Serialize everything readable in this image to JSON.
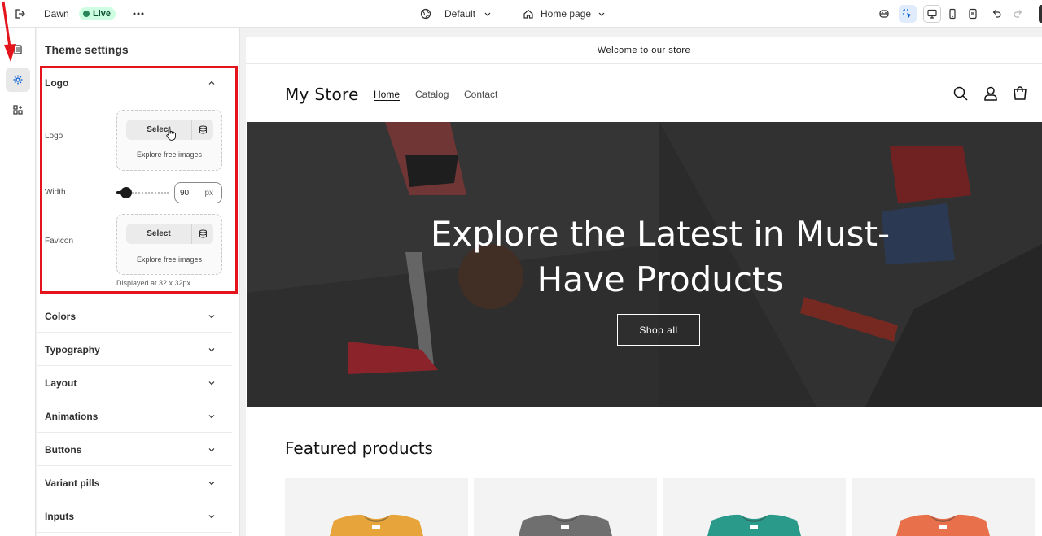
{
  "topbar": {
    "exit_icon": "exit-icon",
    "theme_name": "Dawn",
    "live_label": "Live",
    "more_icon": "more-horizontal-icon",
    "market_icon": "globe-icon",
    "market_label": "Default",
    "page_icon": "home-icon",
    "page_label": "Home page",
    "right_icons": [
      "ai-assistant-icon",
      "inspector-icon",
      "desktop-icon",
      "mobile-icon",
      "fullwidth-icon",
      "undo-icon",
      "redo-icon"
    ]
  },
  "rail": {
    "items": [
      {
        "name": "sections-icon",
        "active": false
      },
      {
        "name": "theme-settings-icon",
        "active": true
      },
      {
        "name": "apps-icon",
        "active": false
      }
    ]
  },
  "panel": {
    "title": "Theme settings",
    "logo_section": {
      "title": "Logo",
      "logo_label": "Logo",
      "logo_select": "Select",
      "logo_free": "Explore free images",
      "width_label": "Width",
      "width_value": "90",
      "width_unit": "px",
      "width_fraction": 0.08,
      "favicon_label": "Favicon",
      "favicon_select": "Select",
      "favicon_free": "Explore free images",
      "favicon_hint": "Displayed at 32 x 32px"
    },
    "sections": [
      {
        "title": "Colors"
      },
      {
        "title": "Typography"
      },
      {
        "title": "Layout"
      },
      {
        "title": "Animations"
      },
      {
        "title": "Buttons"
      },
      {
        "title": "Variant pills"
      },
      {
        "title": "Inputs"
      }
    ]
  },
  "preview": {
    "announcement": "Welcome to our store",
    "store_name": "My Store",
    "nav": [
      {
        "label": "Home",
        "active": true
      },
      {
        "label": "Catalog",
        "active": false
      },
      {
        "label": "Contact",
        "active": false
      }
    ],
    "header_icons": [
      "search-icon",
      "account-icon",
      "cart-icon"
    ],
    "hero_title": "Explore the Latest in Must-Have Products",
    "hero_button": "Shop all",
    "featured_title": "Featured products",
    "product_colors": [
      "#e7a43a",
      "#6f6f6f",
      "#2a9a8a",
      "#e8704a"
    ]
  },
  "colors": {
    "highlight": "#e3141b",
    "live_bg": "#cdfee1"
  }
}
